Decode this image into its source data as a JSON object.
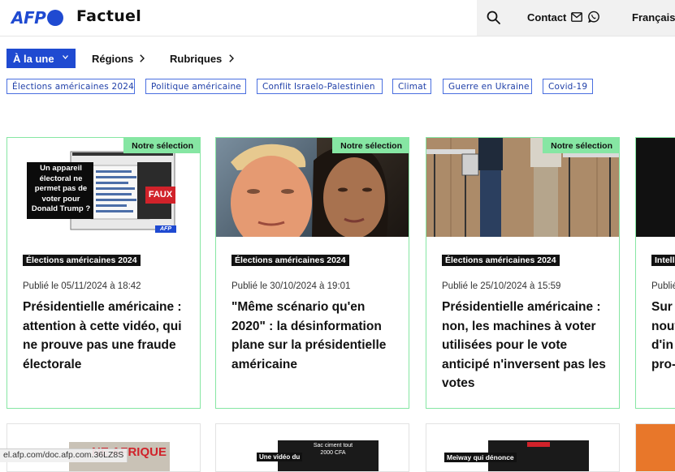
{
  "header": {
    "logo_text": "AFP",
    "site_title": "Factuel",
    "contact_label": "Contact",
    "language_label": "Français",
    "brand_color": "#1f4ad1"
  },
  "nav": {
    "items": [
      {
        "label": "À la une",
        "active": true
      },
      {
        "label": "Régions"
      },
      {
        "label": "Rubriques"
      }
    ]
  },
  "tags": [
    "Élections américaines 2024",
    "Politique américaine",
    "Conflit Israelo-Palestinien",
    "Climat",
    "Guerre en Ukraine",
    "Covid-19"
  ],
  "cards": [
    {
      "badge": "Notre sélection",
      "category": "Élections américaines 2024",
      "date": "Publié le 05/11/2024 à 18:42",
      "title": "Présidentielle américaine : attention à cette vidéo, qui ne prouve pas une fraude électorale",
      "image": {
        "overlay_text": "Un appareil électoral ne permet pas de voter pour Donald Trump ?",
        "stamp": "FAUX",
        "logo": "AFP"
      }
    },
    {
      "badge": "Notre sélection",
      "category": "Élections américaines 2024",
      "date": "Publié le 30/10/2024 à 19:01",
      "title": "\"Même scénario qu'en 2020\" : la désinformation plane sur la présidentielle américaine"
    },
    {
      "badge": "Notre sélection",
      "category": "Élections américaines 2024",
      "date": "Publié le 25/10/2024 à 15:59",
      "title": "Présidentielle américaine : non, les machines à voter utilisées pour le vote anticipé n'inversent pas les votes"
    },
    {
      "category": "Intell",
      "date": "Publié",
      "title": "Sur nouv d'in pro-"
    }
  ],
  "row2": [
    {
      "image_text": "NE AFRIQUE"
    },
    {
      "image_text": "Une vidéo du",
      "image_text2": "Sac ciment tout 2000 CFA"
    },
    {
      "image_text": "Meiway qui dénonce"
    }
  ],
  "status_bar": "el.afp.com/doc.afp.com.36LZ8S"
}
